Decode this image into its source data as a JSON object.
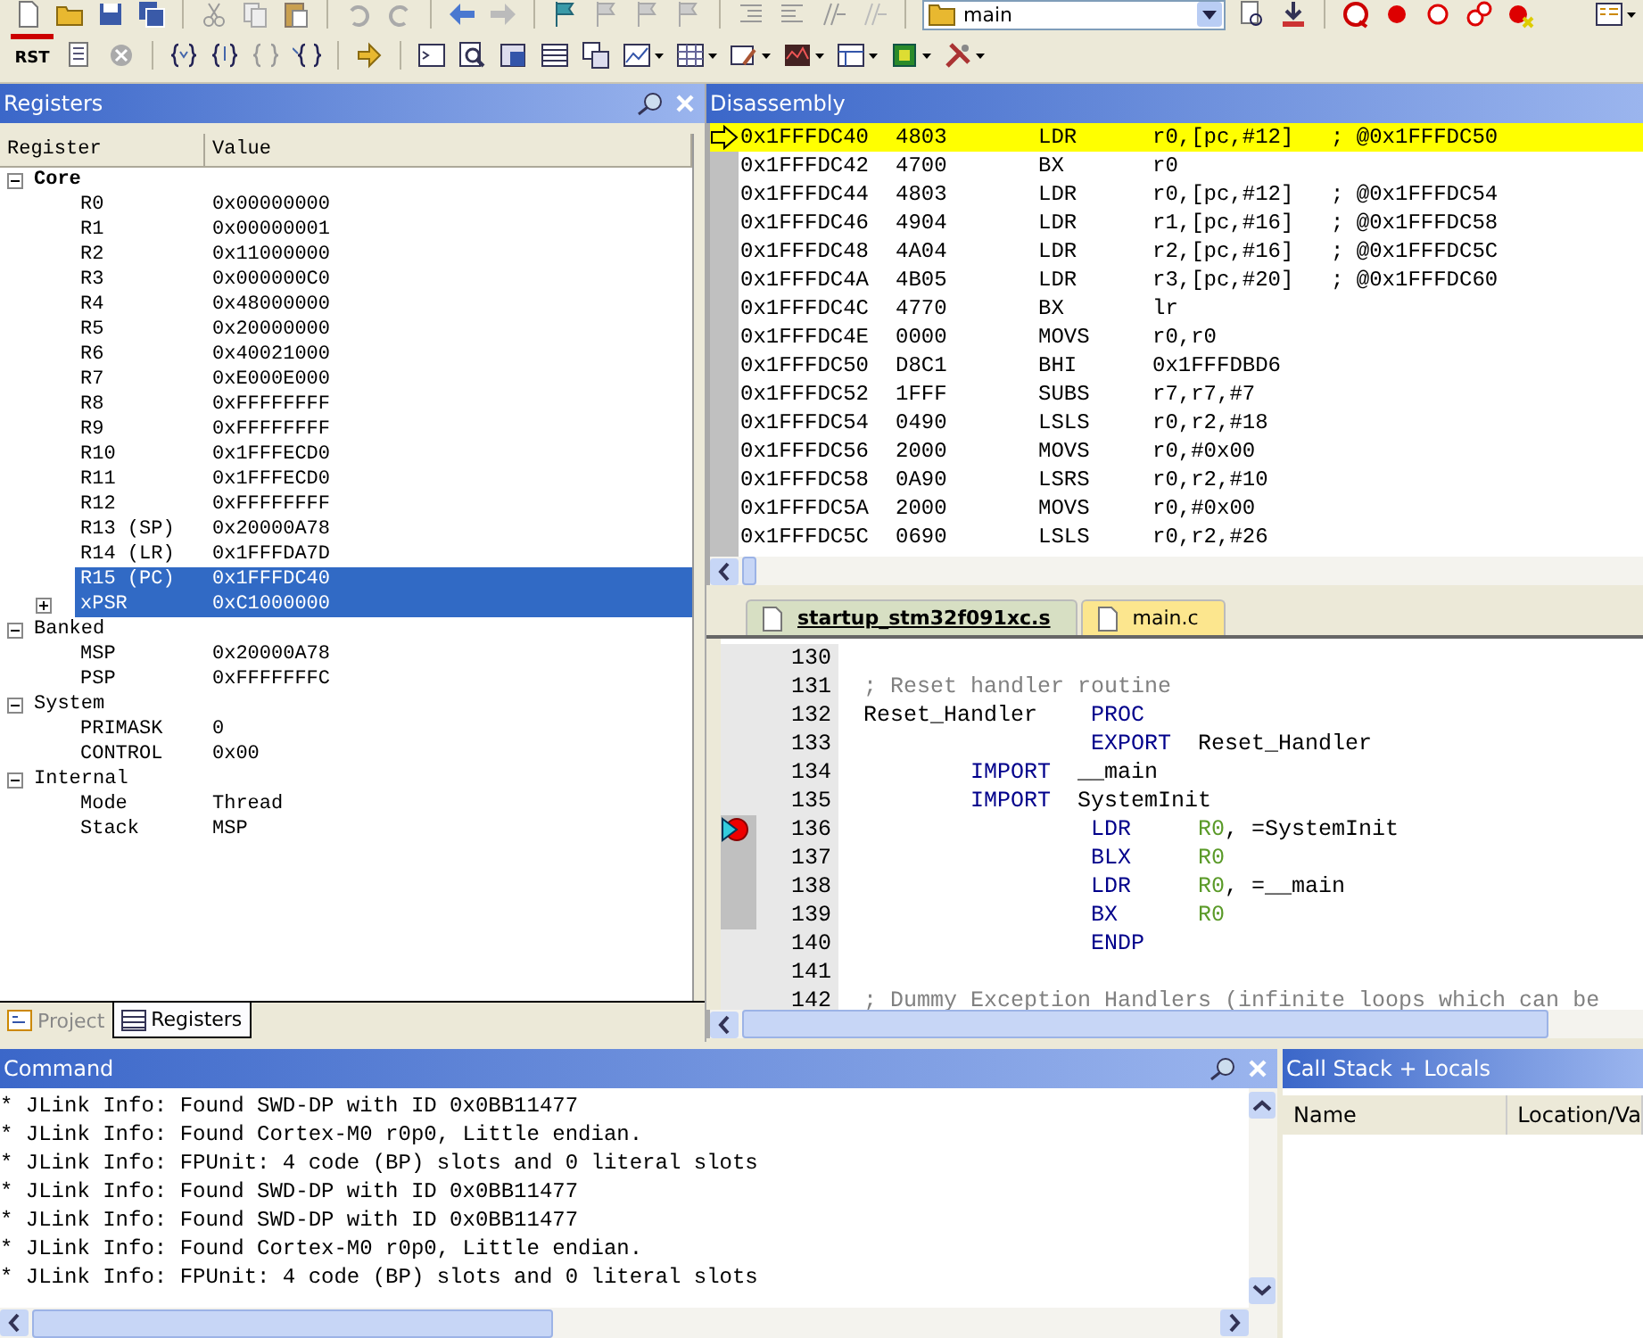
{
  "toolbar": {
    "target": "main",
    "reset_label": "RST"
  },
  "registers_panel": {
    "title": "Registers",
    "columns": [
      "Register",
      "Value"
    ],
    "groups": [
      {
        "name": "Core",
        "expanded": true,
        "children": [
          {
            "name": "R0",
            "value": "0x00000000",
            "selected": false
          },
          {
            "name": "R1",
            "value": "0x00000001",
            "selected": false
          },
          {
            "name": "R2",
            "value": "0x11000000",
            "selected": false
          },
          {
            "name": "R3",
            "value": "0x000000C0",
            "selected": false
          },
          {
            "name": "R4",
            "value": "0x48000000",
            "selected": false
          },
          {
            "name": "R5",
            "value": "0x20000000",
            "selected": false
          },
          {
            "name": "R6",
            "value": "0x40021000",
            "selected": false
          },
          {
            "name": "R7",
            "value": "0xE000E000",
            "selected": false
          },
          {
            "name": "R8",
            "value": "0xFFFFFFFF",
            "selected": false
          },
          {
            "name": "R9",
            "value": "0xFFFFFFFF",
            "selected": false
          },
          {
            "name": "R10",
            "value": "0x1FFFECD0",
            "selected": false
          },
          {
            "name": "R11",
            "value": "0x1FFFECD0",
            "selected": false
          },
          {
            "name": "R12",
            "value": "0xFFFFFFFF",
            "selected": false
          },
          {
            "name": "R13 (SP)",
            "value": "0x20000A78",
            "selected": false
          },
          {
            "name": "R14 (LR)",
            "value": "0x1FFFDA7D",
            "selected": false
          },
          {
            "name": "R15 (PC)",
            "value": "0x1FFFDC40",
            "selected": true
          },
          {
            "name": "xPSR",
            "value": "0xC1000000",
            "selected": true,
            "expanded": false
          }
        ]
      },
      {
        "name": "Banked",
        "expanded": true,
        "children": [
          {
            "name": "MSP",
            "value": "0x20000A78",
            "selected": false
          },
          {
            "name": "PSP",
            "value": "0xFFFFFFFC",
            "selected": false
          }
        ]
      },
      {
        "name": "System",
        "expanded": true,
        "children": [
          {
            "name": "PRIMASK",
            "value": "0",
            "selected": false
          },
          {
            "name": "CONTROL",
            "value": "0x00",
            "selected": false
          }
        ]
      },
      {
        "name": "Internal",
        "expanded": true,
        "children": [
          {
            "name": "Mode",
            "value": "Thread",
            "selected": false
          },
          {
            "name": "Stack",
            "value": "MSP",
            "selected": false
          }
        ]
      }
    ]
  },
  "panel_tabs": [
    {
      "label": "Project",
      "selected": false
    },
    {
      "label": "Registers",
      "selected": true
    }
  ],
  "disassembly": {
    "title": "Disassembly",
    "rows": [
      {
        "address": "0x1FFFDC40",
        "opcode": "4803",
        "mnemonic": "LDR",
        "operands": "r0,[pc,#12]",
        "comment": "; @0x1FFFDC50",
        "current": true
      },
      {
        "address": "0x1FFFDC42",
        "opcode": "4700",
        "mnemonic": "BX",
        "operands": "r0",
        "current": false
      },
      {
        "address": "0x1FFFDC44",
        "opcode": "4803",
        "mnemonic": "LDR",
        "operands": "r0,[pc,#12]",
        "comment": "; @0x1FFFDC54",
        "current": false
      },
      {
        "address": "0x1FFFDC46",
        "opcode": "4904",
        "mnemonic": "LDR",
        "operands": "r1,[pc,#16]",
        "comment": "; @0x1FFFDC58",
        "current": false
      },
      {
        "address": "0x1FFFDC48",
        "opcode": "4A04",
        "mnemonic": "LDR",
        "operands": "r2,[pc,#16]",
        "comment": "; @0x1FFFDC5C",
        "current": false
      },
      {
        "address": "0x1FFFDC4A",
        "opcode": "4B05",
        "mnemonic": "LDR",
        "operands": "r3,[pc,#20]",
        "comment": "; @0x1FFFDC60",
        "current": false
      },
      {
        "address": "0x1FFFDC4C",
        "opcode": "4770",
        "mnemonic": "BX",
        "operands": "lr",
        "current": false
      },
      {
        "address": "0x1FFFDC4E",
        "opcode": "0000",
        "mnemonic": "MOVS",
        "operands": "r0,r0",
        "current": false
      },
      {
        "address": "0x1FFFDC50",
        "opcode": "D8C1",
        "mnemonic": "BHI",
        "operands": "0x1FFFDBD6",
        "current": false
      },
      {
        "address": "0x1FFFDC52",
        "opcode": "1FFF",
        "mnemonic": "SUBS",
        "operands": "r7,r7,#7",
        "current": false
      },
      {
        "address": "0x1FFFDC54",
        "opcode": "0490",
        "mnemonic": "LSLS",
        "operands": "r0,r2,#18",
        "current": false
      },
      {
        "address": "0x1FFFDC56",
        "opcode": "2000",
        "mnemonic": "MOVS",
        "operands": "r0,#0x00",
        "current": false
      },
      {
        "address": "0x1FFFDC58",
        "opcode": "0A90",
        "mnemonic": "LSRS",
        "operands": "r0,r2,#10",
        "current": false
      },
      {
        "address": "0x1FFFDC5A",
        "opcode": "2000",
        "mnemonic": "MOVS",
        "operands": "r0,#0x00",
        "current": false
      },
      {
        "address": "0x1FFFDC5C",
        "opcode": "0690",
        "mnemonic": "LSLS",
        "operands": "r0,r2,#26",
        "current": false
      }
    ]
  },
  "editor": {
    "tabs": [
      {
        "label": "startup_stm32f091xc.s",
        "selected": true
      },
      {
        "label": "main.c",
        "selected": false
      }
    ],
    "lines": [
      {
        "number": "130",
        "breakpoint": false,
        "covered": false
      },
      {
        "number": "131",
        "breakpoint": false,
        "covered": false,
        "segments": [
          {
            "kind": "comment",
            "text": "; Reset handler routine"
          }
        ]
      },
      {
        "number": "132",
        "breakpoint": false,
        "covered": false,
        "segments": [
          {
            "kind": "plain",
            "text": "Reset_Handler    "
          },
          {
            "kind": "keyword",
            "text": "PROC"
          }
        ]
      },
      {
        "number": "133",
        "breakpoint": false,
        "covered": false,
        "segments": [
          {
            "kind": "keyword",
            "text": "                 EXPORT"
          },
          {
            "kind": "plain",
            "text": "  Reset_Handler"
          }
        ]
      },
      {
        "number": "134",
        "breakpoint": false,
        "covered": false,
        "segments": [
          {
            "kind": "keyword",
            "text": "        IMPORT"
          },
          {
            "kind": "plain",
            "text": "  __main"
          }
        ]
      },
      {
        "number": "135",
        "breakpoint": false,
        "covered": false,
        "segments": [
          {
            "kind": "keyword",
            "text": "        IMPORT"
          },
          {
            "kind": "plain",
            "text": "  SystemInit"
          }
        ]
      },
      {
        "number": "136",
        "breakpoint": true,
        "covered": true,
        "segments": [
          {
            "kind": "keyword",
            "text": "                 LDR     "
          },
          {
            "kind": "register",
            "text": "R0"
          },
          {
            "kind": "plain",
            "text": ", =SystemInit"
          }
        ]
      },
      {
        "number": "137",
        "breakpoint": false,
        "covered": true,
        "segments": [
          {
            "kind": "keyword",
            "text": "                 BLX     "
          },
          {
            "kind": "register",
            "text": "R0"
          }
        ]
      },
      {
        "number": "138",
        "breakpoint": false,
        "covered": true,
        "segments": [
          {
            "kind": "keyword",
            "text": "                 LDR     "
          },
          {
            "kind": "register",
            "text": "R0"
          },
          {
            "kind": "plain",
            "text": ", =__main"
          }
        ]
      },
      {
        "number": "139",
        "breakpoint": false,
        "covered": true,
        "segments": [
          {
            "kind": "keyword",
            "text": "                 BX      "
          },
          {
            "kind": "register",
            "text": "R0"
          }
        ]
      },
      {
        "number": "140",
        "breakpoint": false,
        "covered": false,
        "segments": [
          {
            "kind": "keyword",
            "text": "                 ENDP"
          }
        ]
      },
      {
        "number": "141",
        "breakpoint": false,
        "covered": false
      },
      {
        "number": "142",
        "breakpoint": false,
        "covered": false,
        "segments": [
          {
            "kind": "comment",
            "text": "; Dummy Exception Handlers (infinite loops which can be"
          }
        ]
      }
    ]
  },
  "command": {
    "title": "Command",
    "lines": [
      "* JLink Info: Found SWD-DP with ID 0x0BB11477",
      "* JLink Info: Found Cortex-M0 r0p0, Little endian.",
      "* JLink Info: FPUnit: 4 code (BP) slots and 0 literal slots",
      "* JLink Info: Found SWD-DP with ID 0x0BB11477",
      "* JLink Info: Found SWD-DP with ID 0x0BB11477",
      "* JLink Info: Found Cortex-M0 r0p0, Little endian.",
      "* JLink Info: FPUnit: 4 code (BP) slots and 0 literal slots"
    ]
  },
  "call_stack": {
    "title": "Call Stack + Locals",
    "columns": [
      "Name",
      "Location/Va"
    ]
  }
}
